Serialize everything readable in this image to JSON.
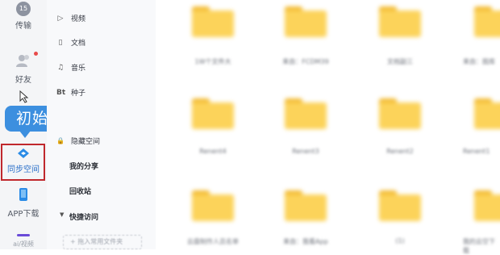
{
  "rail": {
    "items": [
      {
        "icon": "transfer-icon",
        "badge": "15",
        "label": "传输"
      },
      {
        "icon": "friends-icon",
        "label": "好友"
      },
      {
        "icon": "sync-space-icon",
        "label": "同步空间"
      },
      {
        "icon": "phone-icon",
        "label": "APP下载"
      },
      {
        "icon": "more-icon",
        "label": "ai/视频"
      }
    ]
  },
  "callout": {
    "text": "初始化设置"
  },
  "menu": {
    "items": [
      {
        "icon": "▷",
        "label": "视频"
      },
      {
        "icon": "▯",
        "label": "文档"
      },
      {
        "icon": "♫",
        "label": "音乐"
      },
      {
        "icon": "Bt",
        "label": "种子"
      },
      {
        "icon": "🔒",
        "label": "隐藏空间"
      }
    ],
    "my_share": "我的分享",
    "recycle": "回收站",
    "quick_access": "快捷访问",
    "add_folder": "+ 拖入常用文件夹"
  },
  "folders": [
    {
      "name": "1W个文件大"
    },
    {
      "name": "来自：FCDM39"
    },
    {
      "name": "文档副三"
    },
    {
      "name": "来自：图库"
    },
    {
      "name": "Renent4"
    },
    {
      "name": "Renent3"
    },
    {
      "name": "Renent2"
    },
    {
      "name": "Renent1"
    },
    {
      "name": "云盘制作人员名单"
    },
    {
      "name": "来自：我看App"
    },
    {
      "name": "(1)"
    },
    {
      "name": "我的云空下载"
    }
  ],
  "colors": {
    "highlight": "#c0282d",
    "callout_bg": "#3c8fdf",
    "folder": "#fcd35a"
  }
}
